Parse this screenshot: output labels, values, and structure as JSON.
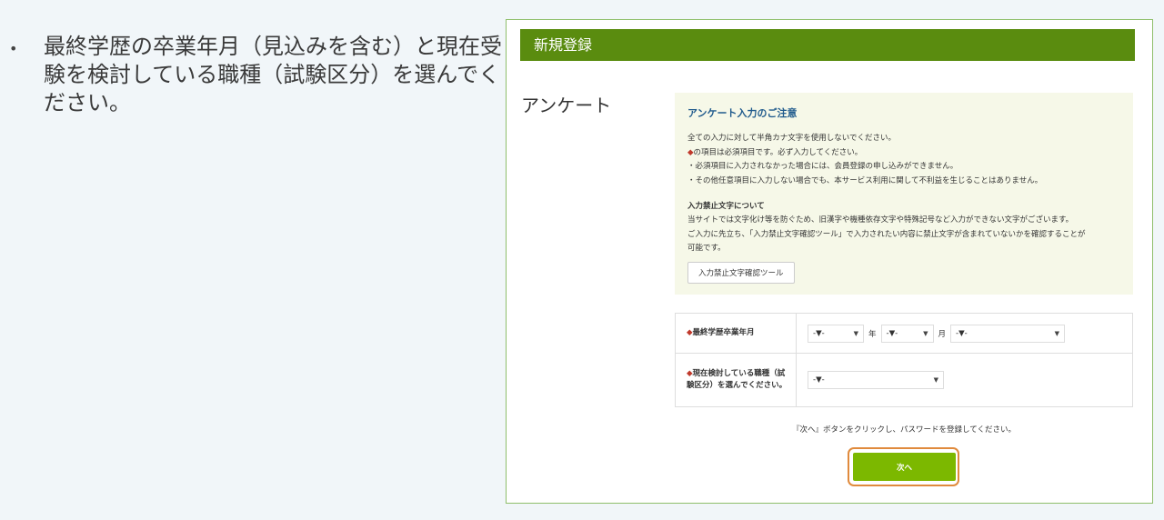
{
  "slide": {
    "bullet": "•",
    "text": "最終学歴の卒業年月（見込みを含む）と現在受験を検討している職種（試験区分）を選んでください。"
  },
  "page": {
    "header_title": "新規登録",
    "section_label": "アンケート",
    "notice": {
      "title": "アンケート入力のご注意",
      "line1": "全ての入力に対して半角カナ文字を使用しないでください。",
      "line2_mark": "◆",
      "line2_text": "の項目は必須項目です。必ず入力してください。",
      "line3": "・必須項目に入力されなかった場合には、会員登録の申し込みができません。",
      "line4": "・その他任意項目に入力しない場合でも、本サービス利用に関して不利益を生じることはありません。",
      "subhead": "入力禁止文字について",
      "body1": "当サイトでは文字化け等を防ぐため、旧漢字や機種依存文字や特殊記号など入力ができない文字がございます。",
      "body2": "ご入力に先立ち、「入力禁止文字確認ツール」で入力されたい内容に禁止文字が含まれていないかを確認することが",
      "body3": "可能です。",
      "tool_button": "入力禁止文字確認ツール"
    },
    "form": {
      "row1": {
        "required_mark": "◆",
        "label": "最終学歴卒業年月",
        "year_select": "-▼-",
        "year_unit": "年",
        "month_select": "-▼-",
        "month_unit": "月",
        "third_select": "-▼-"
      },
      "row2": {
        "required_mark": "◆",
        "label": "現在検討している職種（試験区分）を選んでください。",
        "category_select": "-▼-"
      }
    },
    "instruction": "『次へ』ボタンをクリックし、パスワードを登録してください。",
    "next_button": "次へ"
  },
  "colors": {
    "header_green": "#5a8c0f",
    "button_green": "#7cb800",
    "highlight_orange": "#e08a3c",
    "required_red": "#c0392b"
  }
}
